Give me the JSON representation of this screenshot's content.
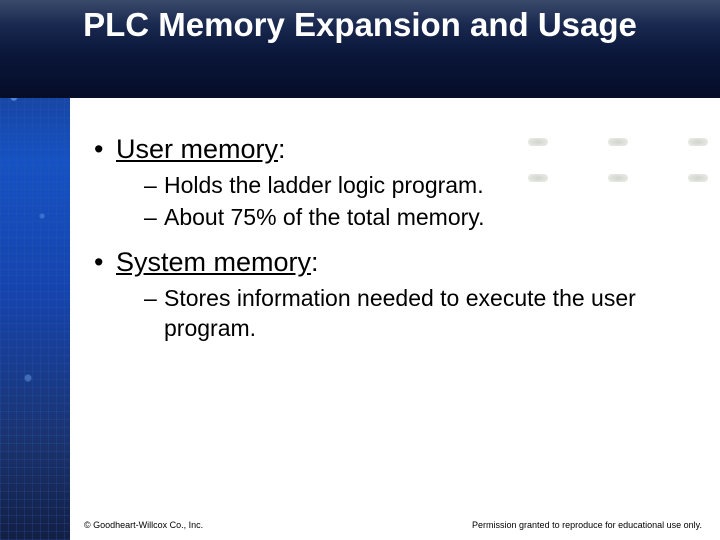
{
  "title": "PLC Memory Expansion and Usage",
  "bullets": [
    {
      "term": "User memory",
      "suffix": ":",
      "subs": [
        "Holds the ladder logic program.",
        "About 75% of the total memory."
      ]
    },
    {
      "term": "System memory",
      "suffix": ":",
      "subs": [
        "Stores information needed to execute the user program."
      ]
    }
  ],
  "footer": {
    "left": "© Goodheart-Willcox Co., Inc.",
    "right": "Permission granted to reproduce for educational use only."
  }
}
